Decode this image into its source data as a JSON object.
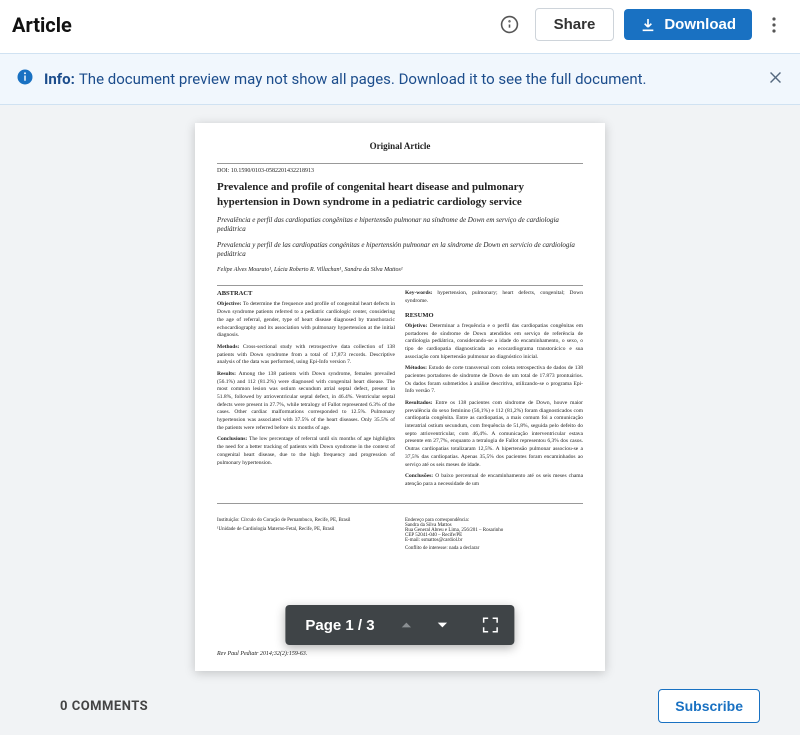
{
  "header": {
    "title": "Article",
    "share_label": "Share",
    "download_label": "Download"
  },
  "banner": {
    "label": "Info:",
    "text": "The document preview may not show all pages. Download it to see the full document."
  },
  "document": {
    "section_label": "Original Article",
    "doi": "DOI: 10.1590/0103-0582201432218913",
    "title_en": "Prevalence and profile of congenital heart disease and pulmonary hypertension in Down syndrome in a pediatric cardiology service",
    "title_pt": "Prevalência e perfil das cardiopatias congênitas e hipertensão pulmonar na síndrome de Down em serviço de cardiologia pediátrica",
    "title_es": "Prevalencia y perfil de las cardiopatías congénitas e hipertensión pulmonar en la síndrome de Down en servicio de cardiología pediátrica",
    "authors": "Felipe Alves Mourato¹, Lúcia Roberto R. Villachan¹, Sandra da Silva Mattos¹",
    "left": {
      "abstract_head": "ABSTRACT",
      "objective": "To determine the frequence and profile of congenital heart defects in Down syndrome patients referred to a pediatric cardiologic center, considering the age of referral, gender, type of heart disease diagnosed by transthoracic echocardiography and its association with pulmonary hypertension at the initial diagnosis.",
      "methods": "Cross-sectional study with retrospective data collection of 138 patients with Down syndrome from a total of 17,873 records. Descriptive analysis of the data was performed, using Epi-Info version 7.",
      "results": "Among the 138 patients with Down syndrome, females prevailed (56.1%) and 112 (81.2%) were diagnosed with congenital heart disease. The most common lesion was ostium secundum atrial septal defect, present in 51.8%, followed by atrioventricular septal defect, in 46.4%. Ventricular septal defects were present in 27.7%, while tetralogy of Fallot represented 6.3% of the cases. Other cardiac malformations corresponded to 12.5%. Pulmonary hypertension was associated with 37.5% of the heart diseases. Only 35.5% of the patients were referred before six months of age.",
      "conclusions": "The low percentage of referral until six months of age highlights the need for a better tracking of patients with Down syndrome in the context of congenital heart disease, due to the high frequency and progression of pulmonary hypertension."
    },
    "right": {
      "keywords_label": "Key-words:",
      "keywords": "hypertension, pulmonary; heart defects, congenital; Down syndrome.",
      "resumo_head": "RESUMO",
      "objetivo": "Determinar a frequência e o perfil das cardiopatias congênitas em portadores de síndrome de Down atendidos em serviço de referência de cardiologia pediátrica, considerando-se a idade do encaminhamento, o sexo, o tipo de cardiopatia diagnosticada ao ecocardiograma transtorácico e sua associação com hipertensão pulmonar ao diagnóstico inicial.",
      "metodos": "Estudo de corte transversal com coleta retrospectiva de dados de 138 pacientes portadores de síndrome de Down de um total de 17.873 prontuários. Os dados foram submetidos à análise descritiva, utilizando-se o programa Epi-Info versão 7.",
      "resultados": "Entre os 138 pacientes com síndrome de Down, houve maior prevalência do sexo feminino (56,1%) e 112 (81,2%) foram diagnosticados com cardiopatia congênita. Entre as cardiopatias, a mais comum foi a comunicação interatrial ostium secundum, com frequência de 51,8%, seguida pelo defeito do septo atrioventricular, com 46,4%. A comunicação interventricular estava presente em 27,7%, enquanto a tetralogia de Fallot representou 6,3% dos casos. Outras cardiopatias totalizaram 12,5%. A hipertensão pulmonar associou-se a 37,5% das cardiopatias. Apenas 35,5% dos pacientes foram encaminhados ao serviço até os seis meses de idade.",
      "conclusoes": "O baixo percentual de encaminhamento até os seis meses chama atenção para a necessidade de um"
    },
    "footer_left_1": "Instituição: Círculo do Coração de Pernambuco, Recife, PE, Brasil",
    "footer_left_2": "¹Unidade de Cardiologia Materno-Fetal, Recife, PE, Brasil",
    "footer_right_1": "Endereço para correspondência:",
    "footer_right_2": "Sandra da Silva Mattos",
    "footer_right_3": "Rua General Abreu e Lima, 256/201 – Rosarinho",
    "footer_right_4": "CEP 52041-040 – Recife/PE",
    "footer_right_5": "E-mail: ssmattos@cardiol.br",
    "footer_right_6": "Conflito de interesse: nada a declarar",
    "journal_ref": "Rev Paul Pediatr 2014;32(2):159-63."
  },
  "labels": {
    "objective": "Objective:",
    "methods": "Methods:",
    "results": "Results:",
    "conclusions": "Conclusions:",
    "objetivo": "Objetivo:",
    "metodos": "Métodos:",
    "resultados": "Resultados:",
    "conclusoes": "Conclusões:"
  },
  "toolbar": {
    "page_info": "Page 1 / 3"
  },
  "comments": {
    "heading": "0 COMMENTS",
    "subscribe_label": "Subscribe"
  }
}
